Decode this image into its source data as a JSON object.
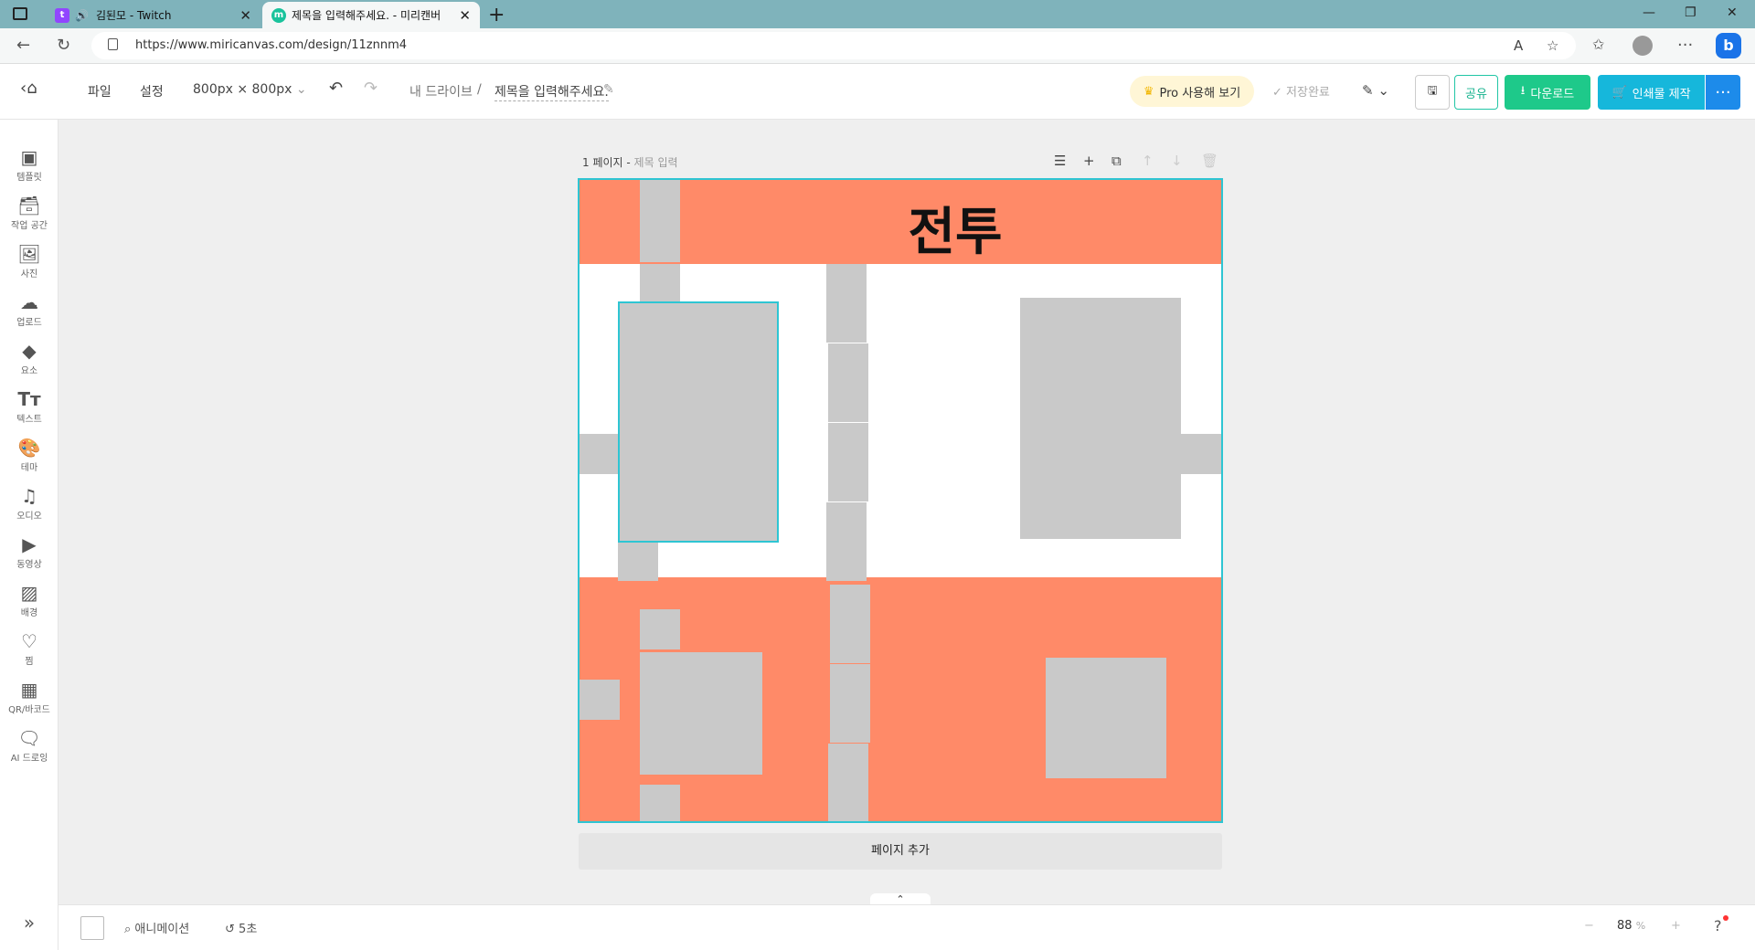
{
  "browser": {
    "tabs": [
      {
        "title": "김된모 - Twitch",
        "favicon": "twitch-icon",
        "active": false
      },
      {
        "title": "제목을 입력해주세요. - 미리캔버",
        "favicon": "miricanvas-icon",
        "active": true
      }
    ],
    "url": "https://www.miricanvas.com/design/11znnm4"
  },
  "toolbar": {
    "file": "파일",
    "settings": "설정",
    "size": "800px × 800px",
    "drive": "내 드라이브",
    "separator": "/",
    "doc_title": "제목을 입력해주세요.",
    "pro": "Pro 사용해 보기",
    "saved": "저장완료",
    "share": "공유",
    "download": "다운로드",
    "print": "인쇄물 제작",
    "more": "···"
  },
  "sidebar": {
    "items": [
      {
        "label": "템플릿",
        "icon": "template-icon"
      },
      {
        "label": "작업 공간",
        "icon": "workspace-icon"
      },
      {
        "label": "사진",
        "icon": "photo-icon"
      },
      {
        "label": "업로드",
        "icon": "upload-icon"
      },
      {
        "label": "요소",
        "icon": "elements-icon"
      },
      {
        "label": "텍스트",
        "icon": "text-icon"
      },
      {
        "label": "테마",
        "icon": "theme-icon"
      },
      {
        "label": "오디오",
        "icon": "audio-icon"
      },
      {
        "label": "동영상",
        "icon": "video-icon"
      },
      {
        "label": "배경",
        "icon": "background-icon"
      },
      {
        "label": "찜",
        "icon": "heart-icon"
      },
      {
        "label": "QR/바코드",
        "icon": "qr-icon"
      },
      {
        "label": "AI 드로잉",
        "icon": "ai-drawing-icon"
      }
    ]
  },
  "page": {
    "label": "1 페이지 -",
    "title_placeholder": "제목 입력",
    "canvas_title": "전투",
    "add_page": "페이지 추가"
  },
  "bottom": {
    "animation": "애니메이션",
    "history": "5초",
    "zoom": "88",
    "zoom_unit": "%"
  },
  "colors": {
    "accent": "#2ec5d3",
    "band": "#ff8a68",
    "placeholder": "#c9c9c9",
    "download": "#1ec98a",
    "print": "#16b7db"
  }
}
